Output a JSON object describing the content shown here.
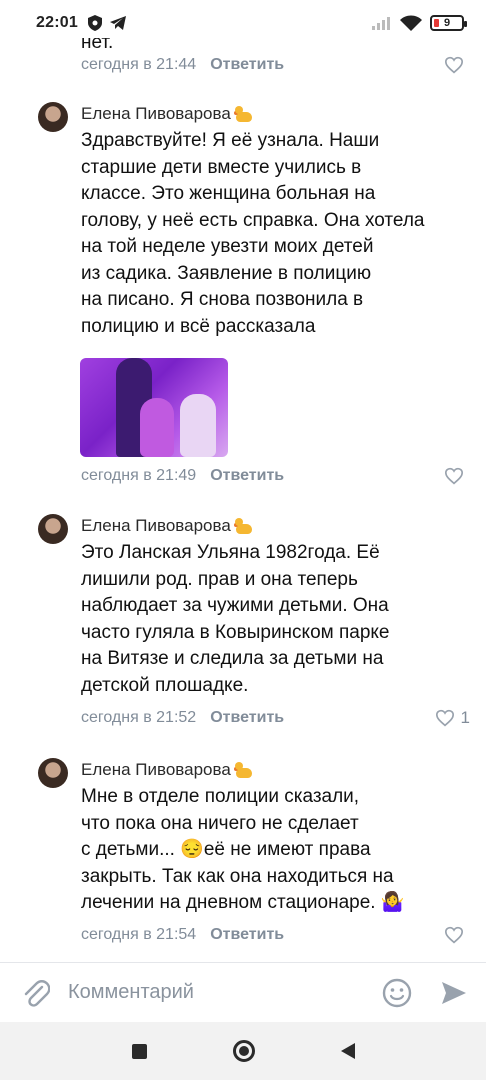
{
  "status_bar": {
    "time": "22:01",
    "battery": "9"
  },
  "comments": [
    {
      "text_partial": "нет.",
      "timestamp": "сегодня в 21:44",
      "reply_label": "Ответить",
      "likes": ""
    },
    {
      "author": "Елена Пивоварова",
      "text": "Здравствуйте! Я её узнала. Наши\nстаршие дети вместе учились в\nклассе. Это женщина больная на\nголову, у неё есть справка. Она хотела\nна той неделе увезти моих детей\nиз садика. Заявление в полицию\nна писано. Я снова позвонила в\nполицию и всё рассказала",
      "has_photo": true,
      "timestamp": "сегодня в 21:49",
      "reply_label": "Ответить",
      "likes": ""
    },
    {
      "author": "Елена Пивоварова",
      "text": "Это Ланская Ульяна 1982года. Её\nлишили род. прав и она теперь\nнаблюдает за чужими детьми. Она\nчасто гуляла в Ковыринском парке\nна Витязе и следила за детьми на\nдетской плошадке.",
      "timestamp": "сегодня в 21:52",
      "reply_label": "Ответить",
      "likes": "1"
    },
    {
      "author": "Елена Пивоварова",
      "text": "Мне в отделе полиции сказали,\nчто пока она ничего не сделает\nс детьми... 😔её не имеют права\nзакрыть. Так как она находиться на\nлечении на дневном стационаре. 🤷‍♀️",
      "timestamp": "сегодня в 21:54",
      "reply_label": "Ответить",
      "likes": ""
    }
  ],
  "input": {
    "placeholder": "Комментарий"
  },
  "icons": {
    "attach": "paperclip-icon",
    "emoji": "smile-icon",
    "send": "send-icon",
    "like": "heart-icon"
  },
  "colors": {
    "meta_gray": "#818c99",
    "text": "#111111",
    "nav_bg": "#f2f2f2"
  }
}
